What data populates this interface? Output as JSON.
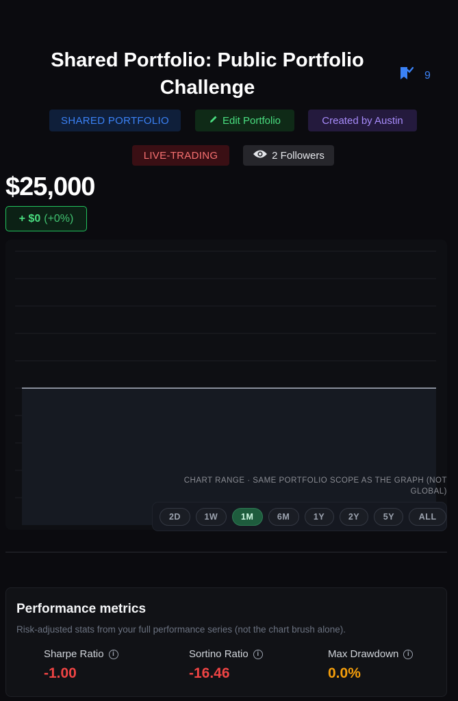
{
  "header": {
    "title": "Shared Portfolio: Public Portfolio Challenge",
    "bookmark_count": "9"
  },
  "badges": {
    "shared": "SHARED PORTFOLIO",
    "edit": "Edit Portfolio",
    "created": "Created by Austin",
    "live": "LIVE-TRADING",
    "followers": "2 Followers"
  },
  "portfolio": {
    "value": "$25,000",
    "change_amount": "+ $0",
    "change_pct": "(+0%)"
  },
  "chart_data": {
    "type": "line",
    "title": "",
    "series": [
      {
        "values": [
          25000,
          25000
        ]
      }
    ],
    "grid": true
  },
  "range": {
    "note": "CHART RANGE · SAME PORTFOLIO SCOPE AS THE GRAPH (NOT GLOBAL)",
    "options": [
      "2D",
      "1W",
      "1M",
      "6M",
      "1Y",
      "2Y",
      "5Y",
      "ALL"
    ],
    "selected": "1M"
  },
  "metrics": {
    "title": "Performance metrics",
    "subtitle": "Risk-adjusted stats from your full performance series (not the chart brush alone).",
    "items": [
      {
        "label": "Sharpe Ratio",
        "value": "-1.00"
      },
      {
        "label": "Sortino Ratio",
        "value": "-16.46"
      },
      {
        "label": "Max Drawdown",
        "value": "0.0%"
      }
    ]
  },
  "colors": {
    "accent_blue": "#3b82f6",
    "positive": "#4ade80",
    "negative": "#ef4444",
    "warning": "#f59e0b"
  }
}
